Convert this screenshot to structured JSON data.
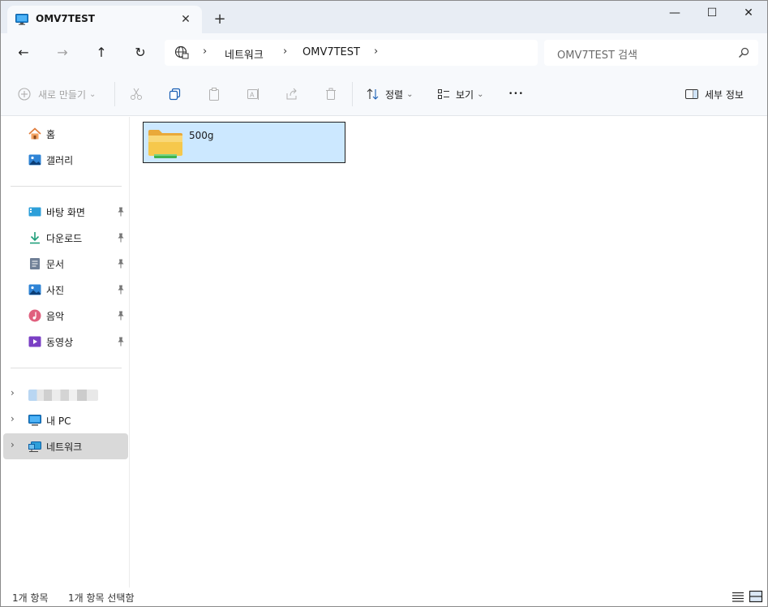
{
  "titlebar": {
    "tab_title": "OMV7TEST",
    "close_tab_glyph": "✕",
    "new_tab_glyph": "+",
    "minimize_glyph": "—",
    "maximize_glyph": "☐",
    "close_glyph": "✕"
  },
  "nav": {
    "back_glyph": "←",
    "forward_glyph": "→",
    "up_glyph": "↑",
    "refresh_glyph": "↻",
    "breadcrumb": [
      "네트워크",
      "OMV7TEST"
    ],
    "sep_glyph": "›",
    "search_placeholder": "OMV7TEST 검색"
  },
  "commands": {
    "new_label": "새로 만들기",
    "sort_label": "정렬",
    "view_label": "보기",
    "more_glyph": "•••",
    "details_label": "세부 정보",
    "dropdown_glyph": "⌄"
  },
  "sidebar": {
    "quick": [
      {
        "label": "홈",
        "icon": "home-icon"
      },
      {
        "label": "갤러리",
        "icon": "gallery-icon"
      }
    ],
    "pinned": [
      {
        "label": "바탕 화면",
        "icon": "desktop-icon"
      },
      {
        "label": "다운로드",
        "icon": "download-icon"
      },
      {
        "label": "문서",
        "icon": "documents-icon"
      },
      {
        "label": "사진",
        "icon": "pictures-icon"
      },
      {
        "label": "음악",
        "icon": "music-icon"
      },
      {
        "label": "동영상",
        "icon": "videos-icon"
      }
    ],
    "tree": [
      {
        "label": "내 PC",
        "icon": "pc-icon"
      },
      {
        "label": "네트워크",
        "icon": "network-icon"
      }
    ],
    "chevron_glyph": "›"
  },
  "content": {
    "items": [
      {
        "name": "500g",
        "type": "network-share-folder",
        "selected": true
      }
    ]
  },
  "status": {
    "item_count": "1개 항목",
    "selected_count": "1개 항목 선택함"
  },
  "colors": {
    "chrome_bg": "#f7f9fc",
    "titlebar_bg": "#e8edf4",
    "selection_bg": "#cce8ff",
    "nav_selected_bg": "#d9d9d9",
    "folder_yellow": "#f6c84c",
    "share_green": "#3fb34f"
  }
}
